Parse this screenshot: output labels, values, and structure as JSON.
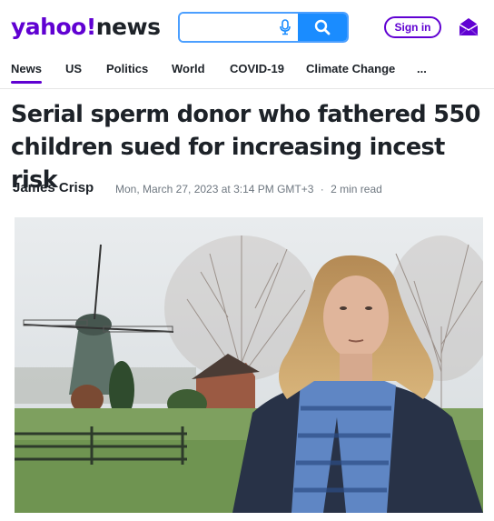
{
  "header": {
    "logo_part1": "yahoo",
    "logo_part2": "!",
    "logo_part3": "news",
    "search_placeholder": "",
    "signin_label": "Sign in"
  },
  "nav": {
    "items": [
      {
        "label": "News",
        "active": true
      },
      {
        "label": "US"
      },
      {
        "label": "Politics"
      },
      {
        "label": "World"
      },
      {
        "label": "COVID-19"
      },
      {
        "label": "Climate Change"
      },
      {
        "label": "..."
      }
    ]
  },
  "article": {
    "headline": "Serial sperm donor who fathered 550 children sued for increasing incest risk",
    "author": "James Crisp",
    "date": "Mon, March 27, 2023 at 3:14 PM GMT+3",
    "separator": "·",
    "read_time": "2 min read"
  },
  "colors": {
    "brand": "#6001d2",
    "search_button": "#1a8cff",
    "search_border": "#4b9fff"
  },
  "icons": [
    "microphone-icon",
    "search-icon",
    "mail-icon"
  ]
}
